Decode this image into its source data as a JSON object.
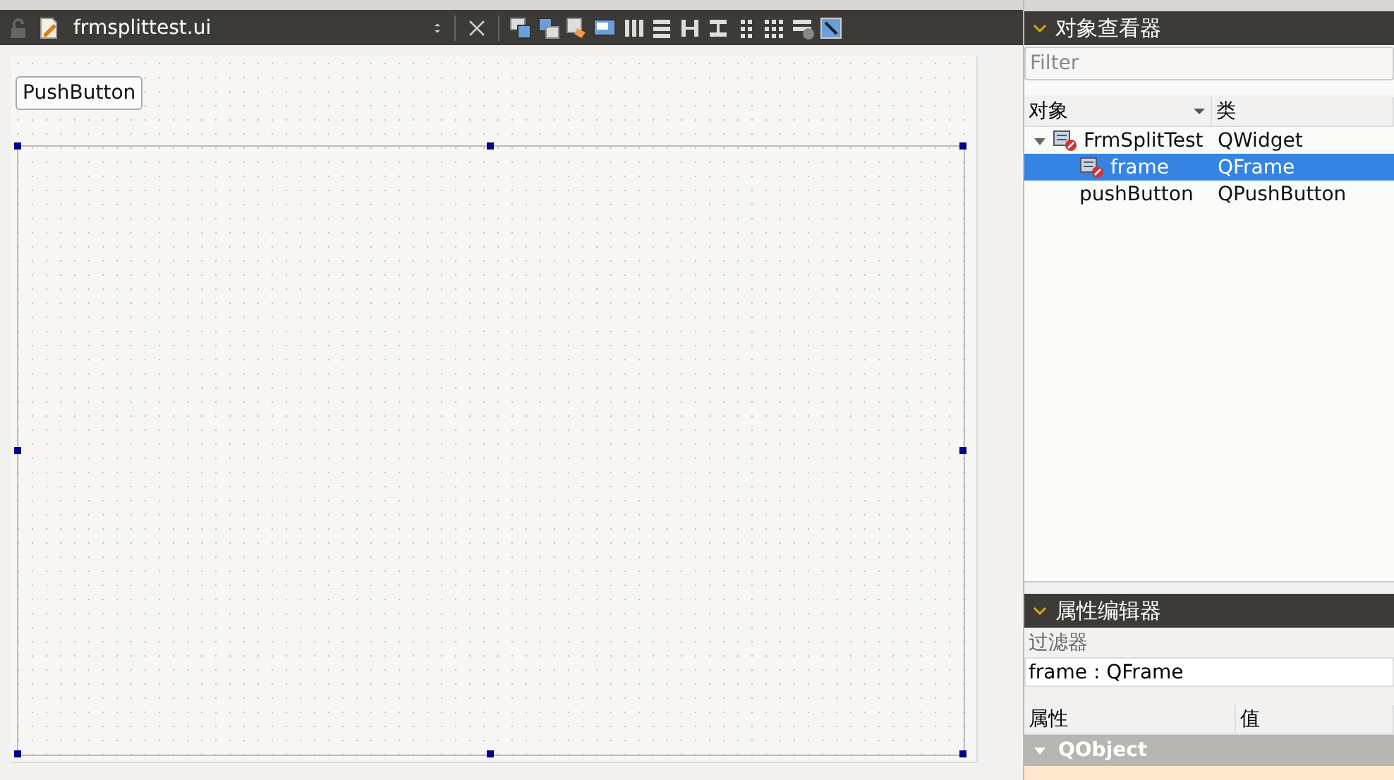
{
  "editor_tab": {
    "file_name": "frmsplittest.ui"
  },
  "form": {
    "push_button": {
      "label": "PushButton"
    },
    "frame": {
      "selected": true
    }
  },
  "object_inspector": {
    "title": "对象查看器",
    "filter": {
      "placeholder": "Filter"
    },
    "columns": [
      "对象",
      "类"
    ],
    "tree": [
      {
        "name": "FrmSplitTest",
        "class": "QWidget",
        "selected": false,
        "expanded": true,
        "children": [
          {
            "name": "frame",
            "class": "QFrame",
            "selected": true
          },
          {
            "name": "pushButton",
            "class": "QPushButton",
            "selected": false
          }
        ]
      }
    ]
  },
  "property_editor": {
    "title": "属性编辑器",
    "filter": {
      "placeholder": "过滤器"
    },
    "object_label": "frame : QFrame",
    "columns": [
      "属性",
      "值"
    ],
    "groups": [
      {
        "name": "QObject",
        "expanded": true
      }
    ]
  }
}
